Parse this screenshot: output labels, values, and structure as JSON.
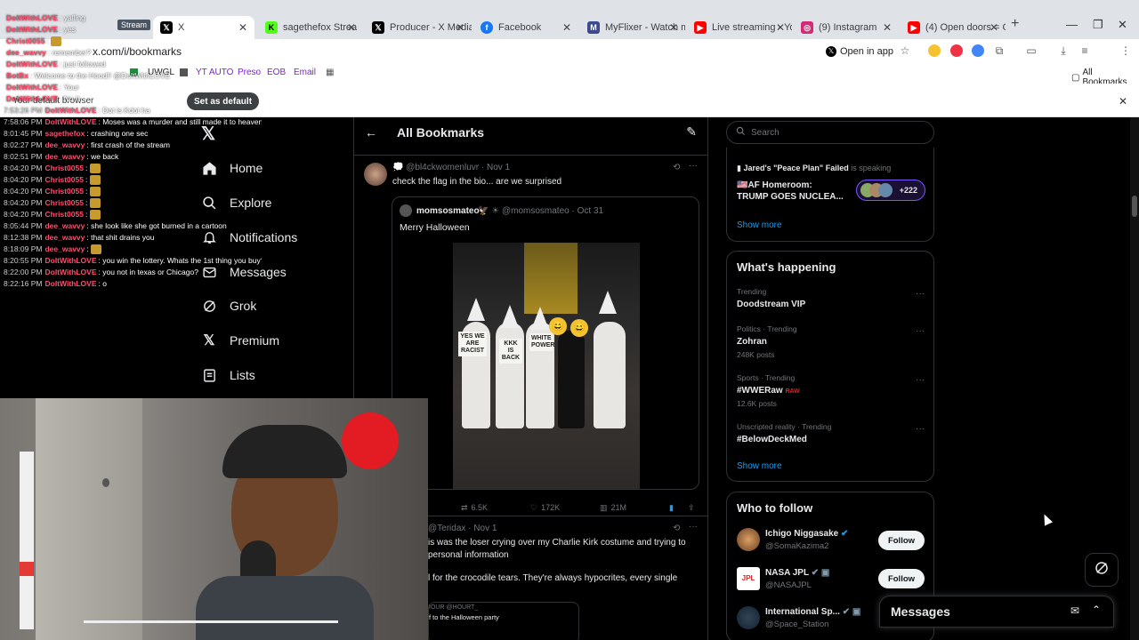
{
  "browser": {
    "tabs": [
      {
        "label": "X",
        "icon": "x-logo",
        "active": true
      },
      {
        "label": "sagethefox Strea",
        "icon": "kick-icon"
      },
      {
        "label": "Producer - X Media",
        "icon": "x-logo"
      },
      {
        "label": "Facebook",
        "icon": "facebook-icon"
      },
      {
        "label": "MyFlixer - Watch mo",
        "icon": "myflixer-icon"
      },
      {
        "label": "Live streaming - You",
        "icon": "youtube-icon"
      },
      {
        "label": "(9) Instagram",
        "icon": "instagram-icon"
      },
      {
        "label": "(4) Open doors = Cu",
        "icon": "youtube-icon"
      }
    ],
    "url": "x.com/i/bookmarks",
    "open_in_app": "Open in app",
    "bookmarks": [
      "Stream",
      "YT AUTO",
      "Preso",
      "EOB",
      "Email",
      "UWGL"
    ],
    "all_bookmarks": "All Bookmarks",
    "infobar_text": "Your default browser",
    "set_default": "Set as default"
  },
  "stream_overlay": {
    "label": "Stream",
    "chat": [
      {
        "time": "",
        "user": "DoItWithLOVE",
        "text": "yalling",
        "color": "#ff4d6d"
      },
      {
        "time": "",
        "user": "DoItWithLOVE",
        "text": "yes",
        "color": "#ff4d6d"
      },
      {
        "time": "",
        "user": "Christ0055",
        "text": "",
        "color": "#ff4d6d"
      },
      {
        "time": "",
        "user": "dee_wavvy",
        "text": "remember?",
        "color": "#ff4d6d"
      },
      {
        "time": "",
        "user": "DoItWithLOVE",
        "text": "just followed",
        "color": "#ff4d6d"
      },
      {
        "time": "",
        "user": "BotBx",
        "text": "Welcome to the Hood!! @DoItWithLOVE",
        "color": "#ff4d6d"
      },
      {
        "time": "",
        "user": "DoItWithLOVE",
        "text": "Your",
        "color": "#ff4d6d"
      },
      {
        "time": "",
        "user": "DoItWithLOVE",
        "text": "No It",
        "color": "#ff4d6d"
      },
      {
        "time": "7:53:26 PM",
        "user": "DoItWithLOVE",
        "text": "Dot is Kdot ha",
        "color": "#ff4d6d"
      },
      {
        "time": "7:58:06 PM",
        "user": "DoItWithLOVE",
        "text": "Moses was a murder and still made it to heaven...",
        "color": "#ff4d6d"
      },
      {
        "time": "8:01:45 PM",
        "user": "sagethefox",
        "text": "crashing one sec",
        "color": "#ff4d6d"
      },
      {
        "time": "8:02:27 PM",
        "user": "dee_wavvy",
        "text": "first crash of the stream",
        "color": "#ff4d6d"
      },
      {
        "time": "8:02:51 PM",
        "user": "dee_wavvy",
        "text": "we back",
        "color": "#ff4d6d"
      },
      {
        "time": "8:04:20 PM",
        "user": "Christ0055",
        "text": "",
        "color": "#ff4d6d"
      },
      {
        "time": "8:04:20 PM",
        "user": "Christ0055",
        "text": "",
        "color": "#ff4d6d"
      },
      {
        "time": "8:04:20 PM",
        "user": "Christ0055",
        "text": "",
        "color": "#ff4d6d"
      },
      {
        "time": "8:04:20 PM",
        "user": "Christ0055",
        "text": "",
        "color": "#ff4d6d"
      },
      {
        "time": "8:04:20 PM",
        "user": "Christ0055",
        "text": "",
        "color": "#ff4d6d"
      },
      {
        "time": "8:05:44 PM",
        "user": "dee_wavvy",
        "text": "she look like she got burned in a cartoon",
        "color": "#ff4d6d"
      },
      {
        "time": "8:12:38 PM",
        "user": "dee_wavvy",
        "text": "that shit drains you",
        "color": "#ff4d6d"
      },
      {
        "time": "8:18:09 PM",
        "user": "dee_wavvy",
        "text": "",
        "color": "#ff4d6d"
      },
      {
        "time": "8:20:55 PM",
        "user": "DoItWithLOVE",
        "text": "you win the lottery. Whats the 1st thing you buy?",
        "color": "#ff4d6d"
      },
      {
        "time": "8:22:00 PM",
        "user": "DoItWithLOVE",
        "text": "you not in texas or Chicago?",
        "color": "#ff4d6d"
      },
      {
        "time": "8:22:16 PM",
        "user": "DoItWithLOVE",
        "text": "o",
        "color": "#ff4d6d"
      }
    ]
  },
  "nav": {
    "items": [
      {
        "label": "Home",
        "icon": "home-icon"
      },
      {
        "label": "Explore",
        "icon": "search-icon"
      },
      {
        "label": "Notifications",
        "icon": "bell-icon"
      },
      {
        "label": "Messages",
        "icon": "mail-icon"
      },
      {
        "label": "Grok",
        "icon": "grok-icon"
      },
      {
        "label": "Premium",
        "icon": "x-logo"
      },
      {
        "label": "Lists",
        "icon": "list-icon"
      }
    ]
  },
  "main": {
    "title": "All Bookmarks",
    "tweet1": {
      "handle": "@bl4ckwomenluvr",
      "date": "Nov 1",
      "text": "check the flag in the bio... are we surprised",
      "quote": {
        "name": "momsosmateo",
        "handle": "@momsosmateo",
        "date": "Oct 31",
        "text": "Merry Halloween",
        "signs": [
          "YES WE ARE RACIST",
          "KKK IS BACK",
          "WHITE POWER"
        ]
      },
      "stats": {
        "retweets": "6.5K",
        "likes": "172K",
        "views": "21M"
      }
    },
    "tweet2": {
      "handle": "@Teridax",
      "date": "Nov 1",
      "line1": "is was the loser crying over my Charlie Kirk costume and trying to",
      "line2": "personal information",
      "line3": "l for the crocodile tears. They're always hypocrites, every single",
      "quote_snip": "f to the Halloween party",
      "quote_tag": "IOUR",
      "quote_handle": "@HOURT_"
    }
  },
  "right": {
    "search_placeholder": "Search",
    "space": {
      "title": "Jared's \"Peace Plan\" Failed",
      "status": "is speaking",
      "show_title": "AF Homeroom: TRUMP GOES NUCLEA...",
      "count": "+222"
    },
    "show_more": "Show more",
    "happening": {
      "title": "What's happening",
      "trends": [
        {
          "context": "Trending",
          "name": "Doodstream VIP",
          "posts": ""
        },
        {
          "context": "Politics · Trending",
          "name": "Zohran",
          "posts": "248K posts"
        },
        {
          "context": "Sports · Trending",
          "name": "#WWERaw",
          "posts": "12.6K posts"
        },
        {
          "context": "Unscripted reality · Trending",
          "name": "#BelowDeckMed",
          "posts": ""
        }
      ]
    },
    "who": {
      "title": "Who to follow",
      "accounts": [
        {
          "name": "Ichigo Niggasake",
          "handle": "@SomaKazima2"
        },
        {
          "name": "NASA JPL",
          "handle": "@NASAJPL"
        },
        {
          "name": "International Sp...",
          "handle": "@Space_Station"
        }
      ],
      "follow_label": "Follow"
    },
    "messages": "Messages"
  },
  "colors": {
    "accent": "#1d9bf0",
    "bg": "#000000",
    "border": "#2f3336"
  }
}
